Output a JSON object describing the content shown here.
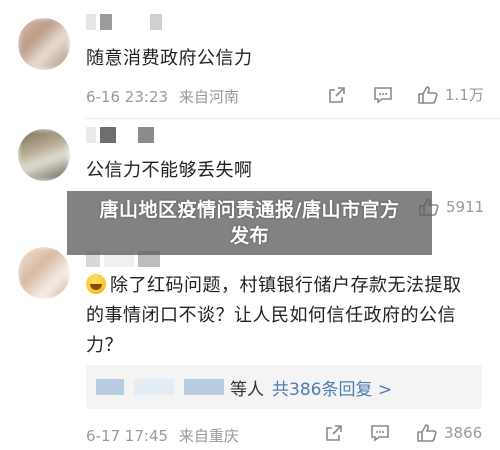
{
  "colors": {
    "link": "#507daf",
    "meta": "#9a9a9a",
    "overlay": "#5f5f5f"
  },
  "headline": {
    "line1": "唐山地区疫情问责通报/唐山市官方",
    "line2": "发布"
  },
  "comments": [
    {
      "text": "随意消费政府公信力",
      "time": "6-16 23:23",
      "location": "来自河南",
      "likes": "1.1万",
      "icons": [
        "share-icon",
        "comment-icon",
        "like-icon"
      ]
    },
    {
      "text": "公信力不能够丢失啊",
      "likes": "5911",
      "icons": [
        "like-icon"
      ]
    },
    {
      "text_line1": "除了红码问题，村镇银行储户存款无法提取",
      "text_line2": "的事情闭口不谈？让人民如何信任政府的公信",
      "text_line3": "力？",
      "reply_suffix": "等人",
      "reply_link": "共386条回复 >",
      "time": "6-17 17:45",
      "location": "来自重庆",
      "likes": "3866",
      "icons": [
        "emoji-grin-icon",
        "share-icon",
        "comment-icon",
        "like-icon"
      ]
    }
  ]
}
